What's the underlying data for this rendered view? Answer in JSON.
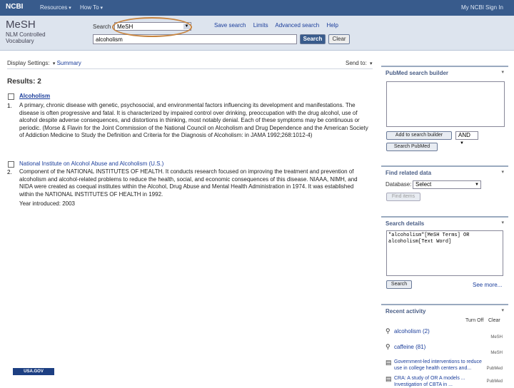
{
  "topbar": {
    "ncbi": "NCBI",
    "resources": "Resources",
    "howto": "How To",
    "my_ncbi": "My NCBI",
    "sign_in": "Sign In"
  },
  "header": {
    "logo": "MeSH",
    "logo_sub": "NLM Controlled Vocabulary",
    "search_label": "Search",
    "db_value": "MeSH",
    "links": [
      "Save search",
      "Limits",
      "Advanced search",
      "Help"
    ],
    "search_value": "alcoholism",
    "search_button": "Search",
    "clear_button": "Clear"
  },
  "results_bar": {
    "display_settings": "Display Settings:",
    "display_value": "Summary",
    "send_to": "Send to:"
  },
  "results": {
    "count_label": "Results: 2",
    "items": [
      {
        "num": "1.",
        "title": "Alcoholism",
        "desc": "A primary, chronic disease with genetic, psychosocial, and environmental factors influencing its development and manifestations. The disease is often progressive and fatal. It is characterized by impaired control over drinking, preoccupation with the drug alcohol, use of alcohol despite adverse consequences, and distortions in thinking, most notably denial. Each of these symptoms may be continuous or periodic. (Morse & Flavin for the Joint Commission of the National Council on Alcoholism and Drug Dependence and the American Society of Addiction Medicine to Study the Definition and Criteria for the Diagnosis of Alcoholism: in JAMA 1992;268:1012-4)",
        "meta": ""
      },
      {
        "num": "2.",
        "title": "National Institute on Alcohol Abuse and Alcoholism (U.S.)",
        "desc": "Component of the NATIONAL INSTITUTES OF HEALTH. It conducts research focused on improving the treatment and prevention of alcoholism and alcohol-related problems to reduce the health, social, and economic consequences of this disease. NIAAA, NIMH, and NIDA were created as coequal institutes within the Alcohol, Drug Abuse and Mental Health Administration in 1974. It was established within the NATIONAL INSTITUTES OF HEALTH in 1992.",
        "meta": "Year introduced: 2003"
      }
    ]
  },
  "footer": {
    "usagov": "USA.GOV"
  },
  "sidebar": {
    "builder": {
      "title": "PubMed search builder",
      "add_button": "Add to search builder",
      "op_value": "AND",
      "search_pubmed": "Search PubMed"
    },
    "related": {
      "title": "Find related data",
      "database_label": "Database:",
      "select_value": "Select",
      "find_button": "Find items"
    },
    "details": {
      "title": "Search details",
      "query": "\"alcoholism\"[MeSH Terms] OR alcoholism[Text Word]",
      "search_button": "Search",
      "see_more": "See more..."
    },
    "activity": {
      "title": "Recent activity",
      "turn_off": "Turn Off",
      "clear": "Clear",
      "items": [
        {
          "label": "alcoholism (2)",
          "db": "MeSH",
          "icon": "magnifier-icon"
        },
        {
          "label": "caffeine (81)",
          "db": "MeSH",
          "icon": "magnifier-icon"
        },
        {
          "label": "Government-led interventions to reduce use in college health centers and...",
          "db": "PubMed",
          "icon": "document-icon"
        },
        {
          "label": "CRA: A study of OR A models ... Investigation of CBTA in ...",
          "db": "PubMed",
          "icon": "document-icon"
        }
      ]
    }
  },
  "colors": {
    "topbar": "#385b8c",
    "header_bg": "#dde4ee",
    "link": "#1a3d9b",
    "highlight_oval": "#c7843f",
    "box_title": "#4a5e86"
  }
}
